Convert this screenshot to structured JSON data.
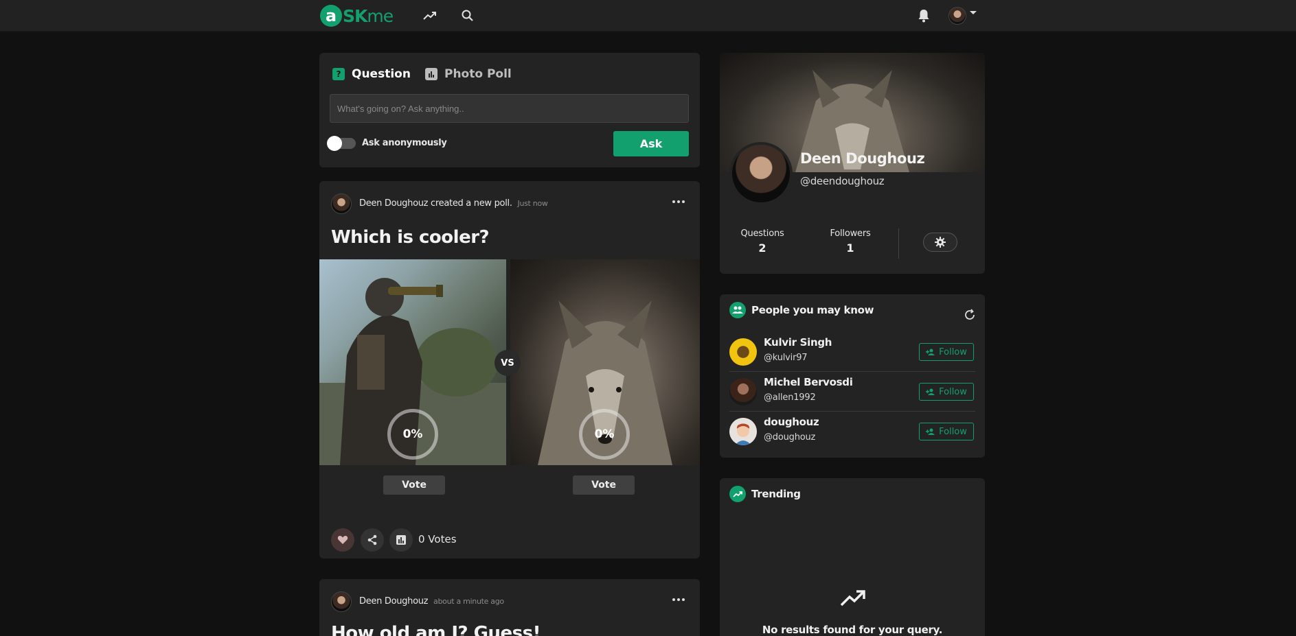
{
  "brand": {
    "logo_a": "a",
    "logo_sk": "SK",
    "logo_me": "me"
  },
  "colors": {
    "accent": "#13a06f",
    "background": "#111111",
    "card": "#232323",
    "topbar": "#222222"
  },
  "topbar": {
    "icons": [
      "trending-icon",
      "search-icon",
      "bell-icon"
    ]
  },
  "composer": {
    "tabs": [
      {
        "label": "Question",
        "icon": "question-icon",
        "icon_glyph": "?"
      },
      {
        "label": "Photo Poll",
        "icon": "poll-icon"
      }
    ],
    "input_placeholder": "What's going on? Ask anything..",
    "anonymous_label": "Ask anonymously",
    "ask_label": "Ask"
  },
  "feed": [
    {
      "author": "Deen Doughouz",
      "action": "created a new poll.",
      "time": "Just now",
      "title": "Which is cooler?",
      "vs_label": "VS",
      "options": [
        {
          "percent": "0%",
          "vote_label": "Vote"
        },
        {
          "percent": "0%",
          "vote_label": "Vote"
        }
      ],
      "votes": "0 Votes"
    },
    {
      "author": "Deen Doughouz",
      "time": "about a minute ago",
      "title": "How old am I? Guess!"
    }
  ],
  "profile": {
    "name": "Deen Doughouz",
    "handle": "@deendoughouz",
    "stats": [
      {
        "label": "Questions",
        "value": "2"
      },
      {
        "label": "Followers",
        "value": "1"
      }
    ]
  },
  "people": {
    "title": "People you may know",
    "items": [
      {
        "name": "Kulvir Singh",
        "handle": "@kulvir97",
        "follow_label": "Follow"
      },
      {
        "name": "Michel Bervosdi",
        "handle": "@allen1992",
        "follow_label": "Follow"
      },
      {
        "name": "doughouz",
        "handle": "@doughouz",
        "follow_label": "Follow"
      }
    ]
  },
  "trending": {
    "title": "Trending",
    "empty_text": "No results found for your query."
  }
}
